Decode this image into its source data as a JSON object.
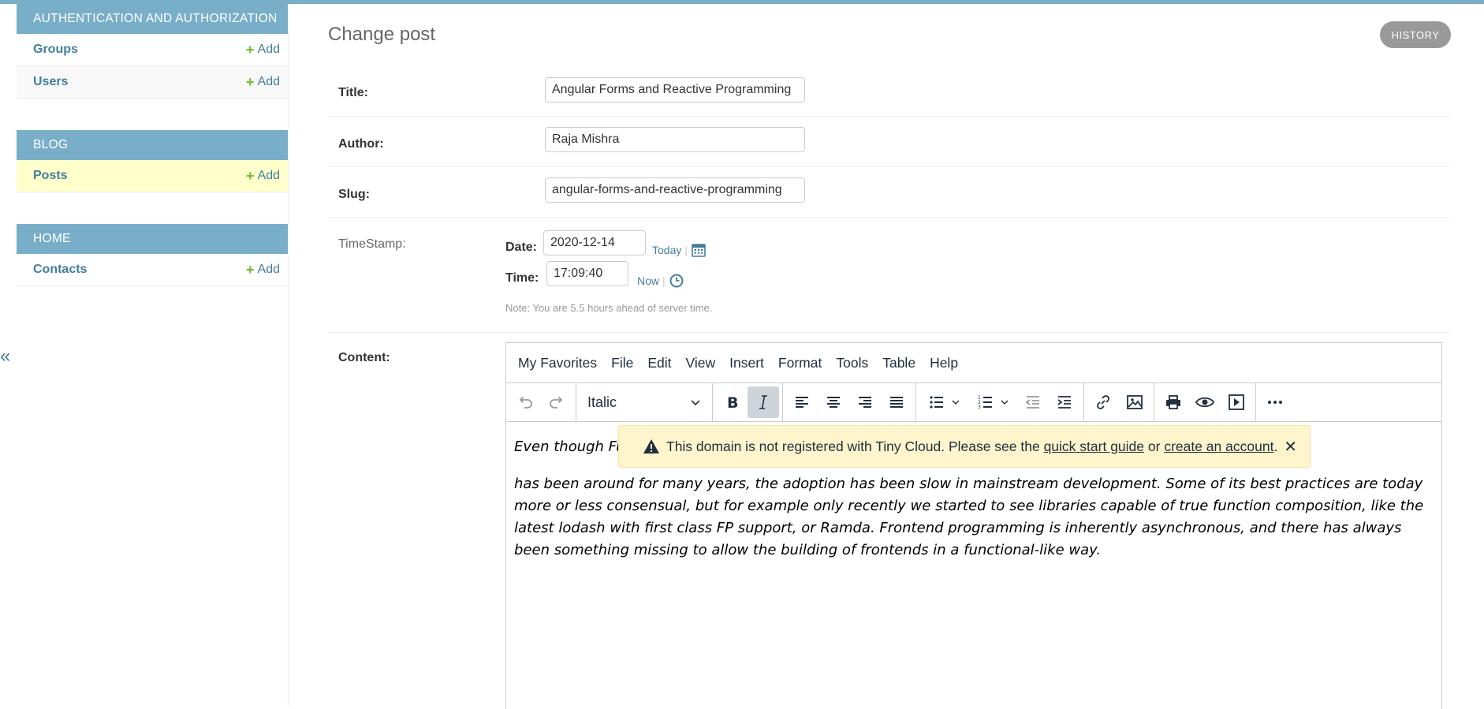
{
  "sidebar": {
    "sections": [
      {
        "header": "Authentication and Authorization",
        "items": [
          {
            "label": "Groups",
            "add": "Add"
          },
          {
            "label": "Users",
            "add": "Add"
          }
        ]
      },
      {
        "header": "Blog",
        "items": [
          {
            "label": "Posts",
            "add": "Add"
          }
        ]
      },
      {
        "header": "Home",
        "items": [
          {
            "label": "Contacts",
            "add": "Add"
          }
        ]
      }
    ],
    "collapse_glyph": "«"
  },
  "page": {
    "title": "Change post",
    "history_button": "HISTORY"
  },
  "form": {
    "title_label": "Title:",
    "title_value": "Angular Forms and Reactive Programming",
    "author_label": "Author:",
    "author_value": "Raja Mishra",
    "slug_label": "Slug:",
    "slug_value": "angular-forms-and-reactive-programming",
    "timestamp_label": "TimeStamp:",
    "date_label": "Date:",
    "date_value": "2020-12-14",
    "today_link": "Today",
    "time_label": "Time:",
    "time_value": "17:09:40",
    "now_link": "Now",
    "separator": "|",
    "timezone_note": "Note: You are 5.5 hours ahead of server time.",
    "content_label": "Content:"
  },
  "editor": {
    "menu": [
      "My Favorites",
      "File",
      "Edit",
      "View",
      "Insert",
      "Format",
      "Tools",
      "Table",
      "Help"
    ],
    "format_select": "Italic",
    "first_line": "Even though Fu",
    "paragraph": "has been around for many years, the adoption has been slow in mainstream development. Some of its best practices are today more or less consensual, but for example only recently we started to see libraries capable of true function composition, like the latest lodash with first class FP support, or Ramda. Frontend programming is inherently asynchronous, and there has always been something missing to allow the building of frontends in a functional-like way."
  },
  "notice": {
    "text_before": "This domain is not registered with Tiny Cloud. Please see the ",
    "link1": "quick start guide",
    "text_mid": " or ",
    "link2": "create an account",
    "text_after": ".",
    "close": "✕"
  },
  "colors": {
    "header_blue": "#79aec8",
    "link_blue": "#447e9b",
    "add_green": "#70bf2b",
    "selected_row": "#ffffcc",
    "notice_bg": "#fff5cc"
  }
}
